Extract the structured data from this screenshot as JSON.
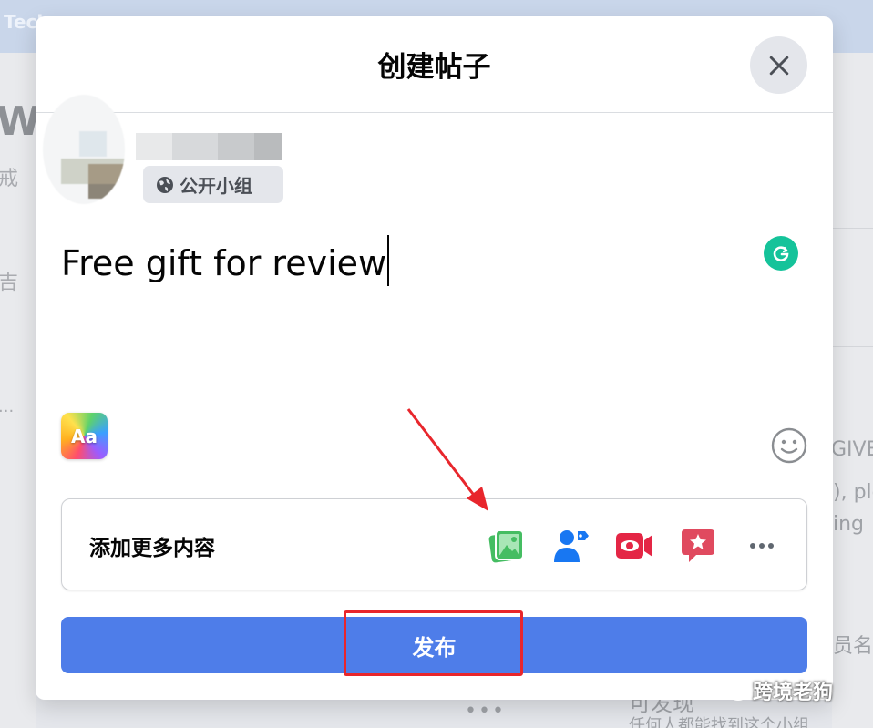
{
  "background": {
    "topbar_text": "Tech",
    "left_big": "W",
    "left_small_1": "戒",
    "left_small_2": "吉",
    "left_dots": "...",
    "right_texts": [
      "GIVE",
      "), plo",
      "ing",
      "员名单"
    ],
    "bottom_text": "可发现",
    "bottom_text_2": "任何人都能找到这个小组",
    "bottom_dots": "•••"
  },
  "modal": {
    "title": "创建帖子",
    "close_icon": "close-icon"
  },
  "author": {
    "privacy_label": "公开小组",
    "privacy_icon": "globe-icon"
  },
  "composer": {
    "text": "Free gift for review",
    "grammarly_icon": "grammarly-icon",
    "text_style_label": "Aa",
    "emoji_icon": "emoji-icon"
  },
  "add_more": {
    "label": "添加更多内容",
    "icons": [
      "photo-video-icon",
      "tag-people-icon",
      "live-video-icon",
      "feeling-icon",
      "more-icon"
    ]
  },
  "publish": {
    "label": "发布"
  },
  "annotation": {
    "arrow_color": "#e8262c",
    "box_color": "#e8262c"
  },
  "watermark": {
    "text": "跨境老狗"
  },
  "colors": {
    "primary": "#4e7de9",
    "photo_green": "#45bd62",
    "tag_blue": "#1877f2",
    "live_red": "#e42645",
    "feeling_red": "#e04a5f"
  }
}
